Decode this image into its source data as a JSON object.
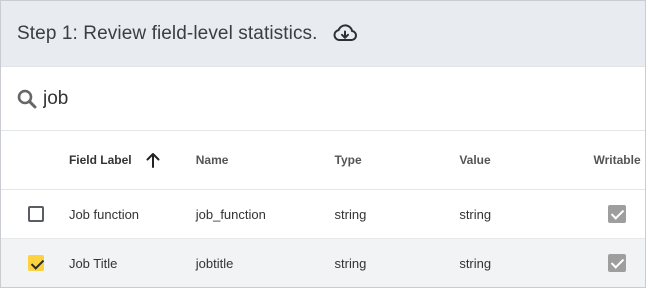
{
  "header": {
    "title": "Step 1: Review field-level statistics.",
    "download_icon": "cloud-download-icon"
  },
  "search": {
    "value": "job",
    "icon": "search-icon"
  },
  "table": {
    "columns": {
      "field_label": "Field Label",
      "name": "Name",
      "type": "Type",
      "value": "Value",
      "writable": "Writable"
    },
    "sort": {
      "column": "Field Label",
      "direction": "ascending"
    },
    "rows": [
      {
        "field_label": "Job function",
        "name": "job_function",
        "type": "string",
        "value": "string",
        "selected": false,
        "writable": true
      },
      {
        "field_label": "Job Title",
        "name": "jobtitle",
        "type": "string",
        "value": "string",
        "selected": true,
        "writable": true
      }
    ]
  },
  "colors": {
    "header_bg": "#e8ecf0",
    "checkbox_checked": "#fdd23f",
    "writable_disabled": "#9e9e9e"
  }
}
